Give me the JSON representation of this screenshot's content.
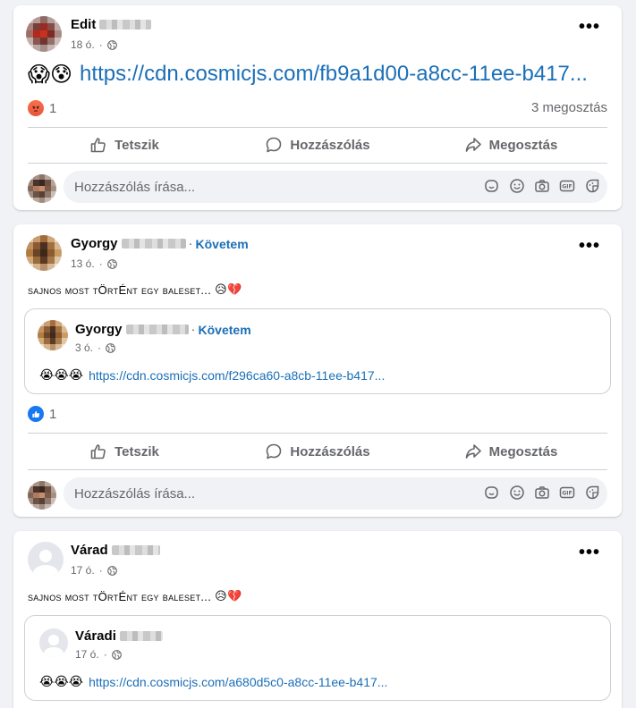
{
  "posts": [
    {
      "author_first": "Edit",
      "time": "18 ó.",
      "dot": "·",
      "emojis": "😱😰",
      "link": "https://cdn.cosmicjs.com/fb9a1d00-a8cc-11ee-b417...",
      "reaction_count": "1",
      "shares": "3 megosztás",
      "reaction_icon": "angry-reaction-icon"
    },
    {
      "author_first": "Gyorgy",
      "follow": "Követem",
      "time": "13 ó.",
      "dot": "·",
      "text": "sajnos most tÖrtÉnt egy baleset...",
      "text_emojis": "😥💔",
      "shared": {
        "author_first": "Gyorgy",
        "follow": "Követem",
        "time": "3 ó.",
        "emojis": "😭😭😭",
        "link": "https://cdn.cosmicjs.com/f296ca60-a8cb-11ee-b417..."
      },
      "reaction_count": "1",
      "reaction_icon": "like-reaction-icon"
    },
    {
      "author_first": "Várad",
      "time": "17 ó.",
      "dot": "·",
      "text": "sajnos most tÖrtÉnt egy baleset...",
      "text_emojis": "😥💔",
      "shared": {
        "author_first": "Váradi",
        "time": "17 ó.",
        "emojis": "😭😭😭",
        "link": "https://cdn.cosmicjs.com/a680d5c0-a8cc-11ee-b417..."
      }
    }
  ],
  "actions": {
    "like": "Tetszik",
    "comment": "Hozzászólás",
    "share": "Megosztás"
  },
  "comment_placeholder": "Hozzászólás írása...",
  "icons": [
    "thumbs-up-icon",
    "comment-bubble-icon",
    "share-arrow-icon",
    "globe-icon",
    "more-options-icon",
    "sticker-icon",
    "emoji-icon",
    "camera-icon",
    "gif-icon",
    "avatar-sticker-icon"
  ],
  "colors": {
    "link": "#1b6fb8",
    "secondary_text": "#65676b",
    "background": "#f0f2f5",
    "like_blue": "#1877f2",
    "angry_orange": "#e8543a"
  }
}
